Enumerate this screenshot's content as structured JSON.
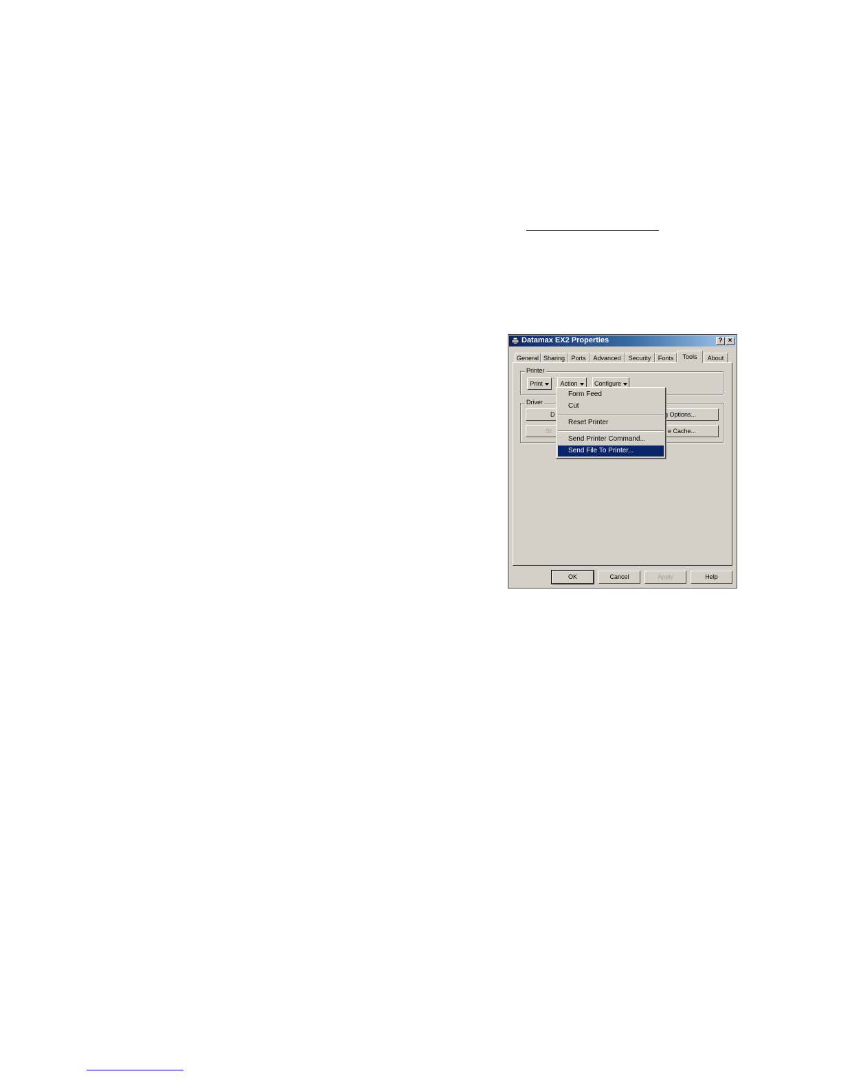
{
  "dialog": {
    "title": "Datamax EX2 Properties",
    "help_label": "?",
    "close_label": "×",
    "tabs": [
      {
        "label": "General"
      },
      {
        "label": "Sharing"
      },
      {
        "label": "Ports"
      },
      {
        "label": "Advanced"
      },
      {
        "label": "Security"
      },
      {
        "label": "Fonts"
      },
      {
        "label": "Tools",
        "selected": true
      },
      {
        "label": "About"
      }
    ],
    "printer_group": {
      "label": "Printer",
      "print_label": "Print",
      "action_label": "Action",
      "configure_label": "Configure"
    },
    "driver_group": {
      "label": "Driver",
      "button1_partial": "D",
      "button2_partial": "g Options...",
      "button3_partial": "St",
      "button4_partial": "e Cache..."
    },
    "action_menu": {
      "items": [
        {
          "label": "Form Feed"
        },
        {
          "label": "Cut"
        },
        {
          "label": "Reset Printer"
        },
        {
          "label": "Send Printer Command..."
        },
        {
          "label": "Send File To Printer...",
          "highlighted": true
        }
      ]
    },
    "footer": {
      "ok_label": "OK",
      "cancel_label": "Cancel",
      "apply_label": "Apply",
      "help_label": "Help"
    }
  },
  "colors": {
    "link_underline": "#0000ee",
    "title_bar": "#0a246a",
    "dialog_face": "#d4d0c8",
    "menu_highlight": "#0a246a"
  }
}
